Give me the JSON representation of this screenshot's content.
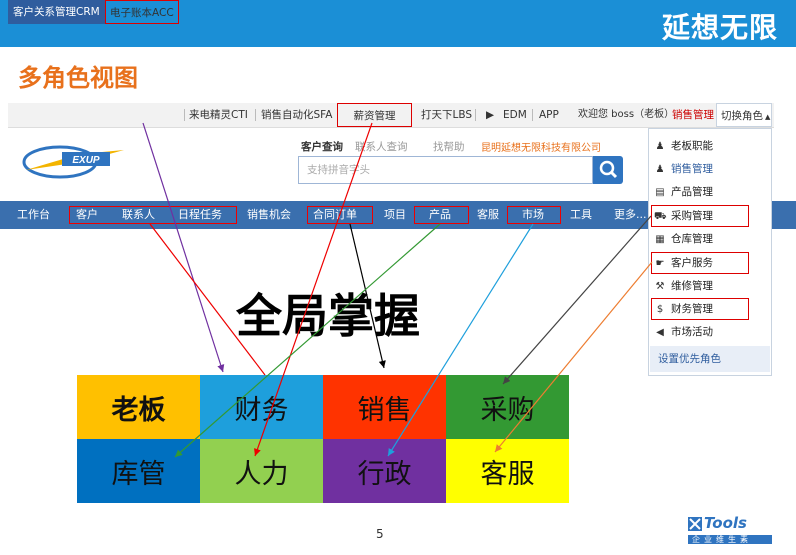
{
  "header": {
    "brand": "延想无限",
    "slide_title": "多角色视图"
  },
  "topbar": {
    "tabs": [
      {
        "label": "客户关系管理CRM"
      },
      {
        "label": "电子账本ACC"
      },
      {
        "label": "来电精灵CTI"
      },
      {
        "label": "销售自动化SFA"
      },
      {
        "label": "薪资管理"
      },
      {
        "label": "打天下LBS"
      },
      {
        "label": "EDM"
      },
      {
        "label": "APP"
      }
    ],
    "welcome": "欢迎您 boss（老板）",
    "role": "销售管理",
    "switch": "切换角色"
  },
  "links": {
    "customer_query": "客户查询",
    "contact_query": "联系人查询",
    "help": "找帮助",
    "company": "昆明延想无限科技有限公司"
  },
  "search": {
    "placeholder": "支持拼音字头"
  },
  "nav": {
    "items": [
      "工作台",
      "客户",
      "联系人",
      "日程任务",
      "销售机会",
      "合同订单",
      "项目",
      "产品",
      "客服",
      "市场",
      "工具",
      "更多..."
    ]
  },
  "role_menu": {
    "items": [
      {
        "label": "老板职能",
        "icon": "boss-icon"
      },
      {
        "label": "销售管理",
        "icon": "sales-icon"
      },
      {
        "label": "产品管理",
        "icon": "product-icon"
      },
      {
        "label": "采购管理",
        "icon": "cart-icon"
      },
      {
        "label": "仓库管理",
        "icon": "warehouse-icon"
      },
      {
        "label": "客户服务",
        "icon": "handshake-icon"
      },
      {
        "label": "维修管理",
        "icon": "wrench-icon"
      },
      {
        "label": "财务管理",
        "icon": "money-bag-icon"
      },
      {
        "label": "市场活动",
        "icon": "megaphone-icon"
      }
    ],
    "footer": "设置优先角色"
  },
  "slide": {
    "headline": "全局掌握",
    "page_number": "5"
  },
  "roles_grid": [
    {
      "label": "老板",
      "color": "#ffc000"
    },
    {
      "label": "财务",
      "color": "#1e9fdc"
    },
    {
      "label": "销售",
      "color": "#ff3300"
    },
    {
      "label": "采购",
      "color": "#339933"
    },
    {
      "label": "库管",
      "color": "#0070c0"
    },
    {
      "label": "人力",
      "color": "#92d050"
    },
    {
      "label": "行政",
      "color": "#7030a0"
    },
    {
      "label": "客服",
      "color": "#ffff00"
    }
  ],
  "footer_logo": {
    "name": "Tools",
    "tagline": "企业维生素"
  }
}
